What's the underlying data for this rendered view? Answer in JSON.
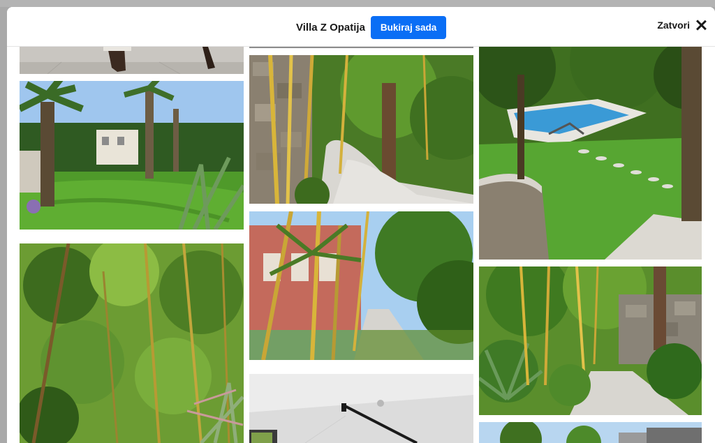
{
  "header": {
    "title": "Villa Z Opatija",
    "book_button_label": "Bukiraj sada",
    "close_label": "Zatvori"
  },
  "icons": {
    "close": "close-icon"
  },
  "colors": {
    "accent": "#0a6ef5",
    "backdrop": "#a9a9a9"
  },
  "gallery": {
    "photos": [
      {
        "name": "photo-terrace-top",
        "column": 1
      },
      {
        "name": "photo-garden-lawn-palms",
        "column": 1
      },
      {
        "name": "photo-bamboo-thicket",
        "column": 1
      },
      {
        "name": "photo-path-top",
        "column": 2
      },
      {
        "name": "photo-bamboo-stone-wall-path",
        "column": 2
      },
      {
        "name": "photo-bamboo-villa-path",
        "column": 2
      },
      {
        "name": "photo-interior-ceiling",
        "column": 2
      },
      {
        "name": "photo-pool-lawn",
        "column": 3
      },
      {
        "name": "photo-bamboo-garden-wall",
        "column": 3
      },
      {
        "name": "photo-trees-bottom",
        "column": 3
      }
    ]
  }
}
